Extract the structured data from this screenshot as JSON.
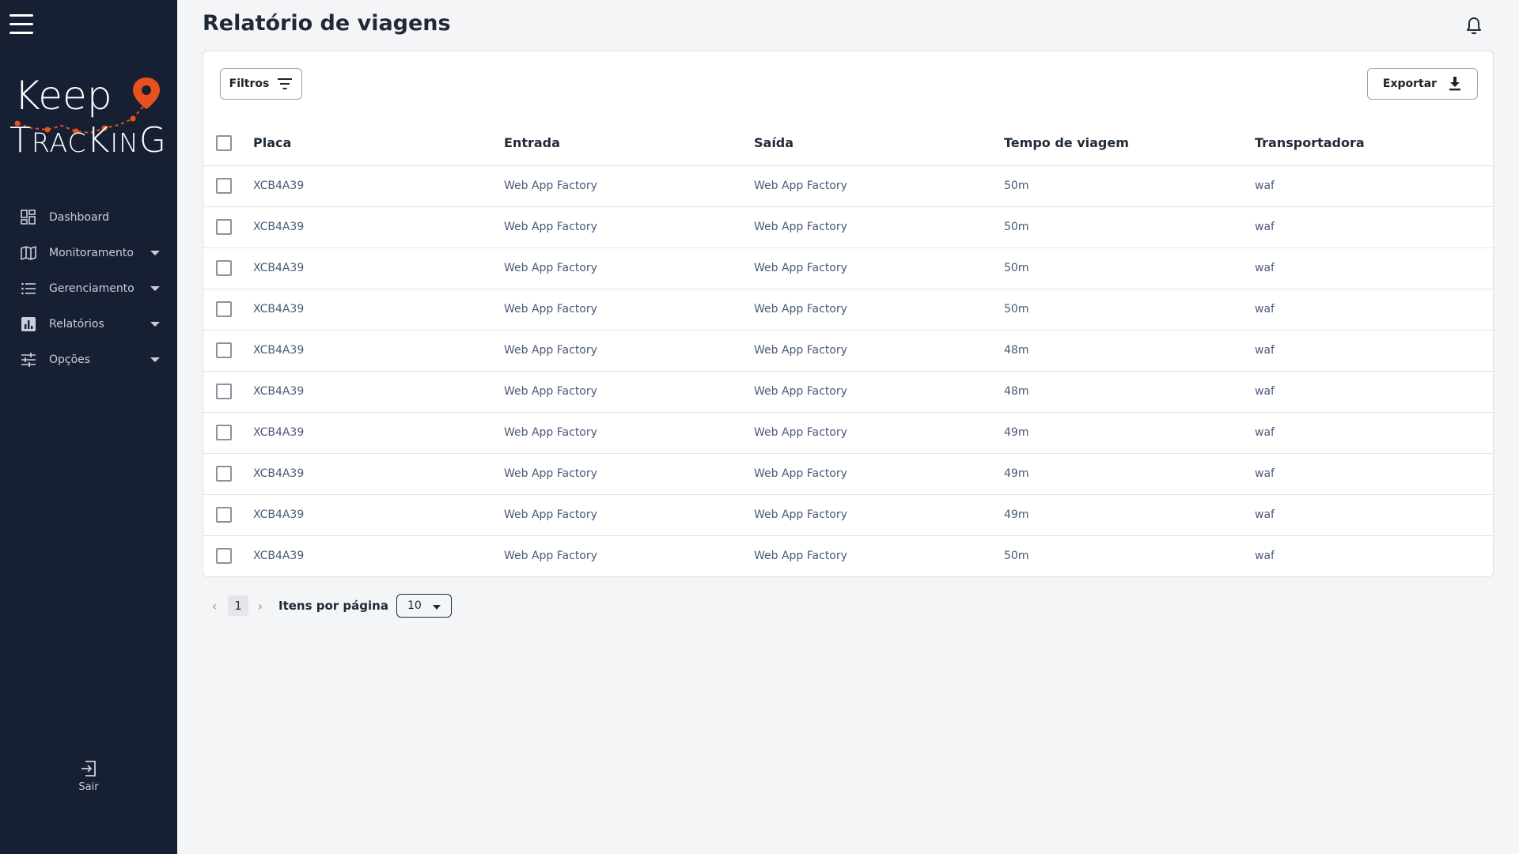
{
  "app": {
    "logo_top": "Keep",
    "logo_bottom": "TRACKING",
    "accent_color": "#e8501e",
    "sidebar_color": "#172033"
  },
  "sidebar": {
    "items": [
      {
        "label": "Dashboard",
        "icon": "dashboard-icon",
        "has_caret": false
      },
      {
        "label": "Monitoramento",
        "icon": "map-icon",
        "has_caret": true
      },
      {
        "label": "Gerenciamento",
        "icon": "list-icon",
        "has_caret": true
      },
      {
        "label": "Relatórios",
        "icon": "report-icon",
        "has_caret": true
      },
      {
        "label": "Opções",
        "icon": "sliders-icon",
        "has_caret": true
      }
    ],
    "logout_label": "Sair"
  },
  "header": {
    "title": "Relatório de viagens"
  },
  "toolbar": {
    "filter_label": "Filtros",
    "export_label": "Exportar"
  },
  "table": {
    "columns": [
      "Placa",
      "Entrada",
      "Saída",
      "Tempo de viagem",
      "Transportadora"
    ],
    "rows": [
      [
        "XCB4A39",
        "Web App Factory",
        "Web App Factory",
        "50m",
        "waf"
      ],
      [
        "XCB4A39",
        "Web App Factory",
        "Web App Factory",
        "50m",
        "waf"
      ],
      [
        "XCB4A39",
        "Web App Factory",
        "Web App Factory",
        "50m",
        "waf"
      ],
      [
        "XCB4A39",
        "Web App Factory",
        "Web App Factory",
        "50m",
        "waf"
      ],
      [
        "XCB4A39",
        "Web App Factory",
        "Web App Factory",
        "48m",
        "waf"
      ],
      [
        "XCB4A39",
        "Web App Factory",
        "Web App Factory",
        "48m",
        "waf"
      ],
      [
        "XCB4A39",
        "Web App Factory",
        "Web App Factory",
        "49m",
        "waf"
      ],
      [
        "XCB4A39",
        "Web App Factory",
        "Web App Factory",
        "49m",
        "waf"
      ],
      [
        "XCB4A39",
        "Web App Factory",
        "Web App Factory",
        "49m",
        "waf"
      ],
      [
        "XCB4A39",
        "Web App Factory",
        "Web App Factory",
        "50m",
        "waf"
      ]
    ]
  },
  "pagination": {
    "current_page": "1",
    "per_page_label": "Itens por página",
    "per_page_value": "10"
  }
}
